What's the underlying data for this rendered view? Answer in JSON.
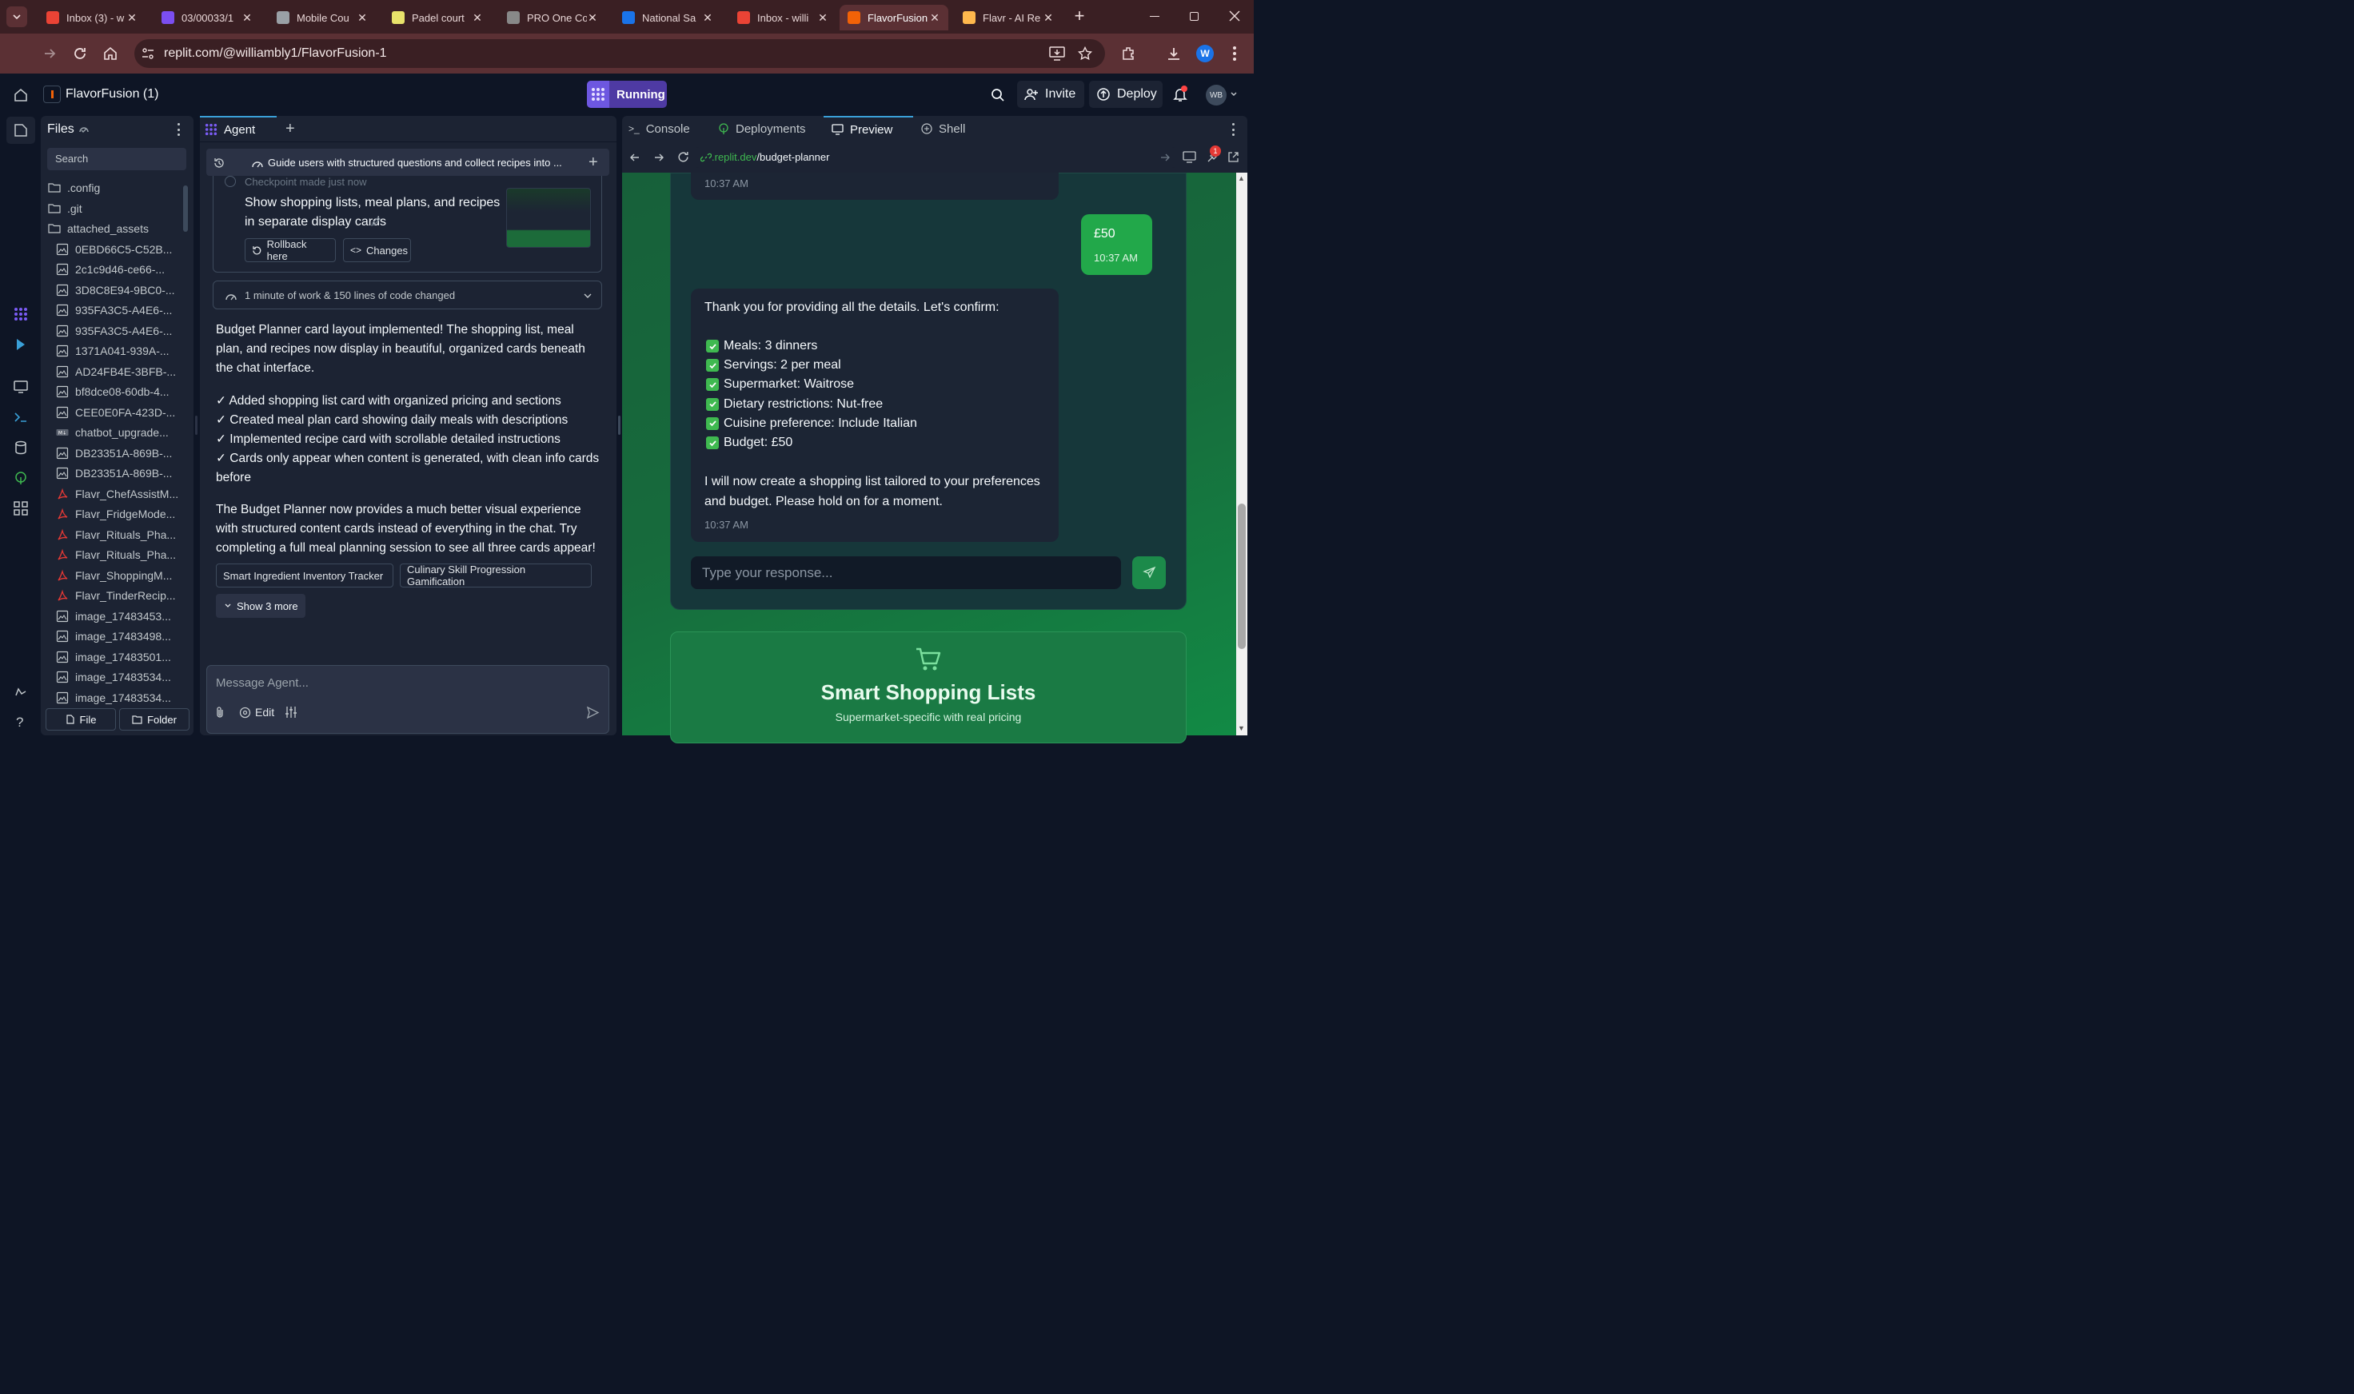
{
  "browser": {
    "tabs": [
      {
        "title": "Inbox (3) - w",
        "icon": "gmail-icon",
        "color": "#ea4335"
      },
      {
        "title": "03/00033/1",
        "icon": "app-icon",
        "color": "#7b4ef0"
      },
      {
        "title": "Mobile Cou",
        "icon": "globe-icon",
        "color": "#9aa0a6"
      },
      {
        "title": "Padel court",
        "icon": "padel-icon",
        "color": "#e8e26a"
      },
      {
        "title": "PRO One Co",
        "icon": "cube-icon",
        "color": "#888888"
      },
      {
        "title": "National Sa",
        "icon": "grid-icon",
        "color": "#1a73e8"
      },
      {
        "title": "Inbox - willi",
        "icon": "gmail-icon",
        "color": "#ea4335"
      },
      {
        "title": "FlavorFusion",
        "icon": "replit-icon",
        "color": "#f26207"
      },
      {
        "title": "Flavr - AI Re",
        "icon": "flavr-icon",
        "color": "#ffb84d"
      }
    ],
    "url": "replit.com/@williambly1/FlavorFusion-1",
    "profile_initial": "W"
  },
  "workspace": {
    "project_name": "FlavorFusion (1)",
    "run_label": "Running",
    "invite_label": "Invite",
    "deploy_label": "Deploy",
    "avatar_initials": "WB"
  },
  "files": {
    "title": "Files",
    "search_placeholder": "Search",
    "items": [
      {
        "name": ".config",
        "type": "folder"
      },
      {
        "name": ".git",
        "type": "folder"
      },
      {
        "name": "attached_assets",
        "type": "folder-open"
      },
      {
        "name": "0EBD66C5-C52B...",
        "type": "image"
      },
      {
        "name": "2c1c9d46-ce66-...",
        "type": "image"
      },
      {
        "name": "3D8C8E94-9BC0-...",
        "type": "image"
      },
      {
        "name": "935FA3C5-A4E6-...",
        "type": "image"
      },
      {
        "name": "935FA3C5-A4E6-...",
        "type": "image"
      },
      {
        "name": "1371A041-939A-...",
        "type": "image"
      },
      {
        "name": "AD24FB4E-3BFB-...",
        "type": "image"
      },
      {
        "name": "bf8dce08-60db-4...",
        "type": "image"
      },
      {
        "name": "CEE0E0FA-423D-...",
        "type": "image"
      },
      {
        "name": "chatbot_upgrade...",
        "type": "markdown"
      },
      {
        "name": "DB23351A-869B-...",
        "type": "image"
      },
      {
        "name": "DB23351A-869B-...",
        "type": "image"
      },
      {
        "name": "Flavr_ChefAssistM...",
        "type": "pdf"
      },
      {
        "name": "Flavr_FridgeMode...",
        "type": "pdf"
      },
      {
        "name": "Flavr_Rituals_Pha...",
        "type": "pdf"
      },
      {
        "name": "Flavr_Rituals_Pha...",
        "type": "pdf"
      },
      {
        "name": "Flavr_ShoppingM...",
        "type": "pdf"
      },
      {
        "name": "Flavr_TinderRecip...",
        "type": "pdf"
      },
      {
        "name": "image_17483453...",
        "type": "image"
      },
      {
        "name": "image_17483498...",
        "type": "image"
      },
      {
        "name": "image_17483501...",
        "type": "image"
      },
      {
        "name": "image_17483534...",
        "type": "image"
      },
      {
        "name": "image_17483534...",
        "type": "image"
      }
    ],
    "new_file_label": "File",
    "new_folder_label": "Folder"
  },
  "agent": {
    "tab_label": "Agent",
    "task_title": "Guide users with structured questions and collect recipes into ...",
    "checkpoint_label": "Checkpoint made just now",
    "checkpoint_text": "Show shopping lists, meal plans, and recipes in separate display cards",
    "rollback_label": "Rollback here",
    "changes_label": "Changes",
    "work_summary": "1 minute of work & 150 lines of code changed",
    "message_intro": "Budget Planner card layout implemented! The shopping list, meal plan, and recipes now display in beautiful, organized cards beneath the chat interface.",
    "checklist": [
      "✓ Added shopping list card with organized pricing and sections",
      "✓ Created meal plan card showing daily meals with descriptions",
      "✓ Implemented recipe card with scrollable detailed instructions",
      "✓ Cards only appear when content is generated, with clean info cards before"
    ],
    "message_outro": "The Budget Planner now provides a much better visual experience with structured content cards instead of everything in the chat. Try completing a full meal planning session to see all three cards appear!",
    "suggestions": [
      "Smart Ingredient Inventory Tracker",
      "Culinary Skill Progression Gamification"
    ],
    "show_more_label": "Show 3 more",
    "input_placeholder": "Message Agent...",
    "edit_label": "Edit"
  },
  "preview_tabs": {
    "console": "Console",
    "deployments": "Deployments",
    "preview": "Preview",
    "shell": "Shell"
  },
  "preview": {
    "url_host": ".replit.dev",
    "url_path": "/budget-planner",
    "devtools_badge": "1",
    "top_time": "10:37 AM",
    "user_message": "£50",
    "user_time": "10:37 AM",
    "bot_intro": "Thank you for providing all the details. Let's confirm:",
    "bot_items": [
      "Meals: 3 dinners",
      "Servings: 2 per meal",
      "Supermarket: Waitrose",
      "Dietary restrictions: Nut-free",
      "Cuisine preference: Include Italian",
      "Budget: £50"
    ],
    "bot_outro": "I will now create a shopping list tailored to your preferences and budget. Please hold on for a moment.",
    "bot_time": "10:37 AM",
    "response_placeholder": "Type your response...",
    "feature_title": "Smart Shopping Lists",
    "feature_subtitle": "Supermarket-specific with real pricing"
  },
  "colors": {
    "chrome_tabbar": "#3a1f23",
    "chrome_toolbar": "#5b3034",
    "replit_bg": "#0e1525",
    "replit_panel": "#1c2333",
    "run_accent": "#7b5cf5",
    "preview_green": "#166b3a",
    "user_bubble": "#22a84a",
    "bot_bubble": "#1c2534"
  }
}
